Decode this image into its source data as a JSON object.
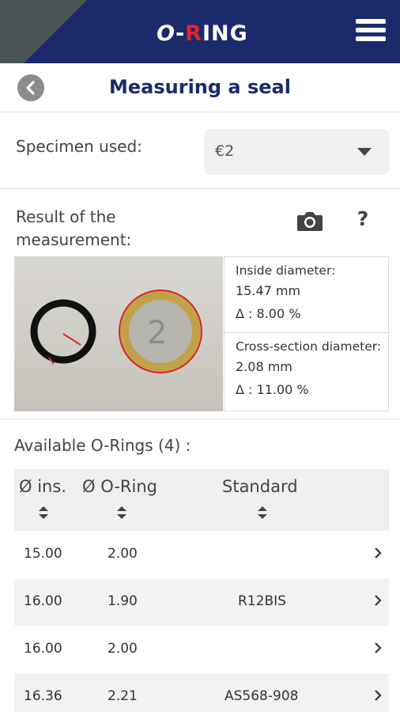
{
  "header": {
    "logo_o": "O",
    "logo_dash": "-",
    "logo_r": "R",
    "logo_ing": "ING",
    "menu_icon": "hamburger-menu-icon"
  },
  "titlebar": {
    "back_icon": "back-arrow-icon",
    "title": "Measuring a seal"
  },
  "specimen": {
    "label": "Specimen used:",
    "selected": "€2"
  },
  "measurement": {
    "title": "Result of the measurement:",
    "camera_icon": "camera-icon",
    "help_icon": "help-icon",
    "help_glyph": "?",
    "inside": {
      "label": "Inside diameter:",
      "value": "15.47 mm",
      "delta": "Δ : 8.00 %"
    },
    "cross": {
      "label": "Cross-section diameter:",
      "value": "2.08 mm",
      "delta": "Δ : 11.00 %"
    }
  },
  "available": {
    "title": "Available O-Rings (4) :",
    "columns": [
      "Ø ins.",
      "Ø O-Ring",
      "Standard"
    ],
    "rows": [
      {
        "ins": "15.00",
        "oring": "2.00",
        "standard": ""
      },
      {
        "ins": "16.00",
        "oring": "1.90",
        "standard": "R12BIS"
      },
      {
        "ins": "16.00",
        "oring": "2.00",
        "standard": ""
      },
      {
        "ins": "16.36",
        "oring": "2.21",
        "standard": "AS568-908"
      }
    ]
  },
  "colors": {
    "header_bg": "#1b2a6b",
    "accent_red": "#e1262c",
    "corner": "#4a5456"
  }
}
